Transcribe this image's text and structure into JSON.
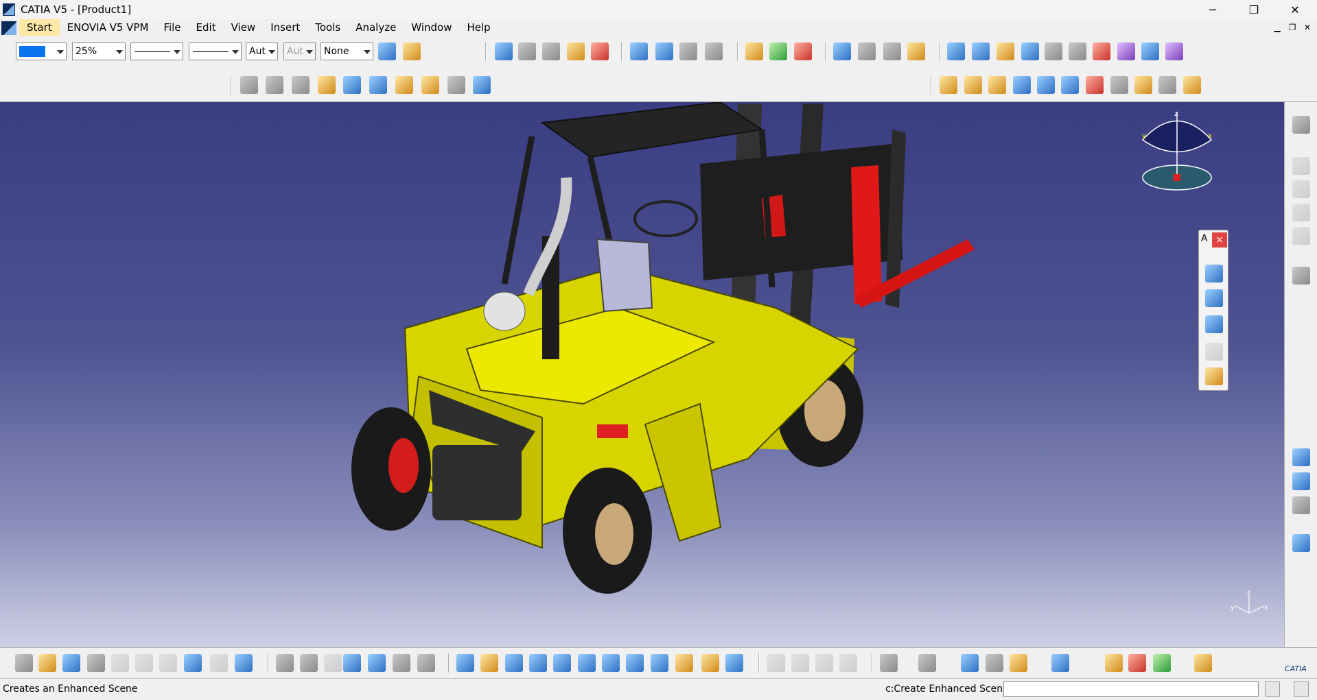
{
  "window": {
    "title": "CATIA V5 - [Product1]",
    "minimize": "─",
    "maximize": "❐",
    "close": "✕"
  },
  "menu": {
    "items": [
      "Start",
      "ENOVIA V5 VPM",
      "File",
      "Edit",
      "View",
      "Insert",
      "Tools",
      "Analyze",
      "Window",
      "Help"
    ]
  },
  "toolbar": {
    "color_value": "",
    "color_accent": "#0a74f0",
    "transparency_value": "25%",
    "line_thickness_value": "",
    "line_type_value": "",
    "point_value": "Aut",
    "layer_value": "Aut",
    "layer_none_value": "None"
  },
  "floating_panel": {
    "title": "A",
    "close": "×"
  },
  "compass": {
    "axis_z": "z",
    "axis_x": "x",
    "axis_y": "y"
  },
  "axis_indicator": {
    "x": "x",
    "y": "y",
    "z": "z"
  },
  "status": {
    "message": "Creates an Enhanced Scene",
    "command_prompt": "c:Create Enhanced Scene",
    "command_value": ""
  },
  "logo": {
    "text": "CATIA"
  },
  "colors": {
    "forklift_body": "#d8d400",
    "forks": "#e01818",
    "frame": "#222222",
    "viewport_top": "#3a3d82"
  }
}
